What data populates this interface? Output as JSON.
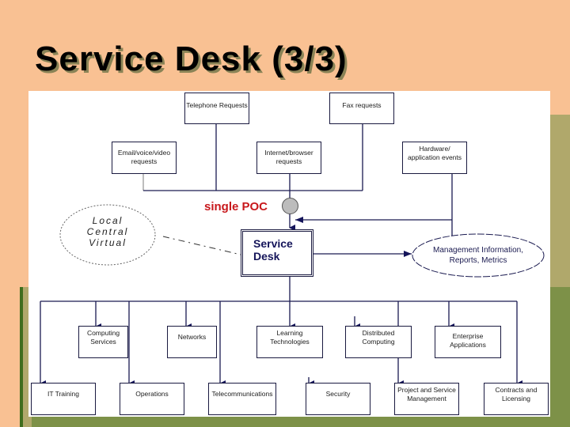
{
  "slide": {
    "title": "Service Desk (3/3)"
  },
  "colors": {
    "background": "#f9c193",
    "olive_band": "#b0a86b",
    "green_band": "#7d9148",
    "line": "#1a1a50",
    "poc_label": "#c8181c"
  },
  "diagram": {
    "inputs": [
      {
        "id": "telephone",
        "label": "Telephone Requests"
      },
      {
        "id": "fax",
        "label": "Fax requests"
      },
      {
        "id": "email",
        "label": "Email/voice/video requests"
      },
      {
        "id": "internet",
        "label": "Internet/browser requests"
      },
      {
        "id": "hardware",
        "label": "Hardware/ application events"
      }
    ],
    "poc_label": "single POC",
    "service_desk_label": "Service Desk",
    "models_label_lines": [
      "Local",
      "Central",
      "Virtual"
    ],
    "output_label_lines": [
      "Management Information,",
      "Reports, Metrics"
    ],
    "groups_row1": [
      {
        "id": "computing-services",
        "label": "Computing Services"
      },
      {
        "id": "networks",
        "label": "Networks"
      },
      {
        "id": "learning-technologies",
        "label": "Learning Technologies"
      },
      {
        "id": "distributed-computing",
        "label": "Distributed Computing"
      },
      {
        "id": "enterprise-applications",
        "label": "Enterprise Applications"
      }
    ],
    "groups_row2": [
      {
        "id": "it-training",
        "label": "IT Training"
      },
      {
        "id": "operations",
        "label": "Operations"
      },
      {
        "id": "telecommunications",
        "label": "Telecommunications"
      },
      {
        "id": "security",
        "label": "Security"
      },
      {
        "id": "project-service-management",
        "label": "Project and Service Management"
      },
      {
        "id": "contracts-licensing",
        "label": "Contracts and Licensing"
      }
    ]
  }
}
